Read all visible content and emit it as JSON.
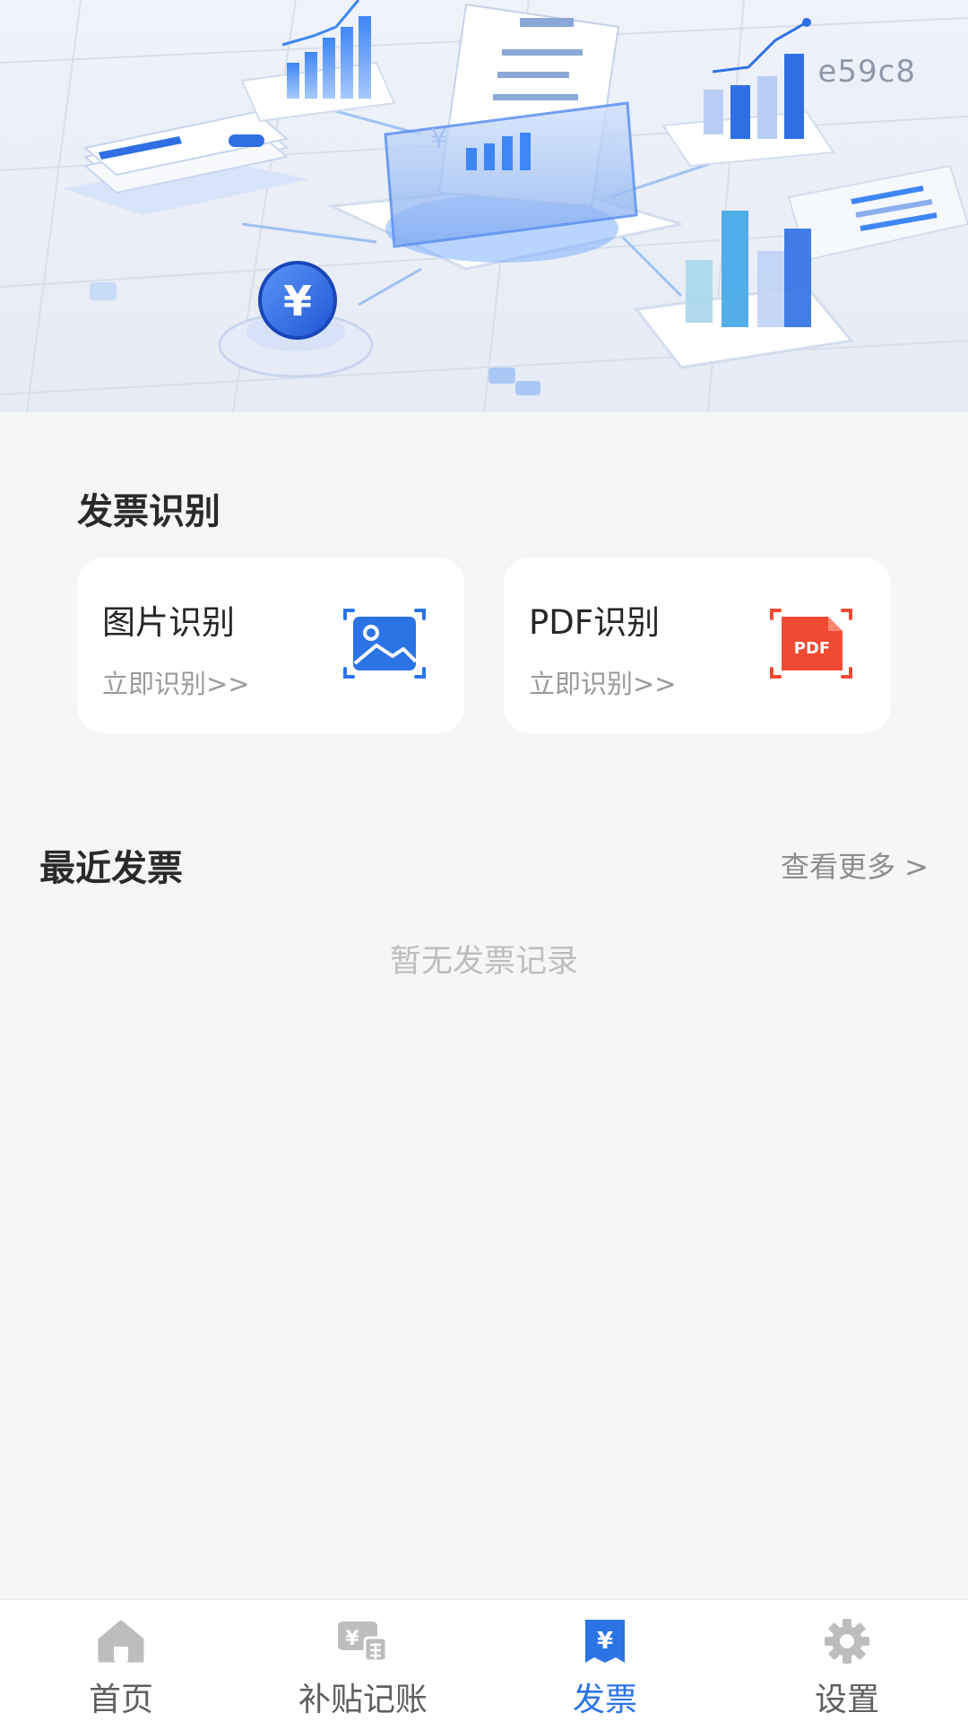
{
  "hero": {
    "code": "e59c8",
    "coin_symbol": "¥"
  },
  "recognition": {
    "title": "发票识别",
    "image_card": {
      "title": "图片识别",
      "action": "立即识别>>",
      "icon": "image-scan-icon"
    },
    "pdf_card": {
      "title": "PDF识别",
      "action": "立即识别>>",
      "icon": "pdf-scan-icon",
      "badge": "PDF"
    }
  },
  "recent": {
    "title": "最近发票",
    "more": "查看更多 >",
    "empty": "暂无发票记录"
  },
  "tabbar": {
    "items": [
      {
        "label": "首页",
        "icon": "home-icon"
      },
      {
        "label": "补贴记账",
        "icon": "ledger-icon",
        "icon_text": "¥"
      },
      {
        "label": "发票",
        "icon": "invoice-icon",
        "icon_text": "¥",
        "active": true
      },
      {
        "label": "设置",
        "icon": "gear-icon"
      }
    ]
  },
  "colors": {
    "accent": "#2c74e6",
    "pdf": "#f04a32",
    "background": "#f6f6f6"
  }
}
